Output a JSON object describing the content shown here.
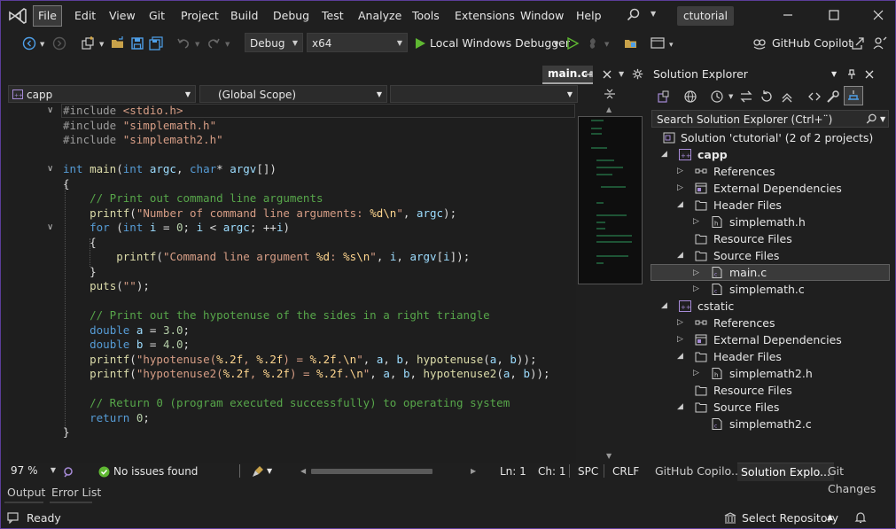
{
  "menu": [
    "File",
    "Edit",
    "View",
    "Git",
    "Project",
    "Build",
    "Debug",
    "Test",
    "Analyze",
    "Tools",
    "Extensions",
    "Window",
    "Help"
  ],
  "solution_name_badge": "ctutorial",
  "toolbar": {
    "config": "Debug",
    "platform": "x64",
    "debugger_label": "Local Windows Debugger",
    "copilot_label": "GitHub Copilot"
  },
  "editor": {
    "tab_label": "main.c",
    "project_combo": "capp",
    "scope_combo": "(Global Scope)",
    "zoom": "97 %",
    "issues": "No issues found",
    "ln": "Ln: 1",
    "ch": "Ch: 1",
    "indent": "SPC",
    "eol": "CRLF"
  },
  "code_lines": [
    "#include <stdio.h>",
    "#include \"simplemath.h\"",
    "#include \"simplemath2.h\"",
    "",
    "int main(int argc, char* argv[])",
    "{",
    "    // Print out command line arguments",
    "    printf(\"Number of command line arguments: %d\\n\", argc);",
    "    for (int i = 0; i < argc; ++i)",
    "    {",
    "        printf(\"Command line argument %d: %s\\n\", i, argv[i]);",
    "    }",
    "    puts(\"\");",
    "",
    "    // Print out the hypotenuse of the sides in a right triangle",
    "    double a = 3.0;",
    "    double b = 4.0;",
    "    printf(\"hypotenuse(%.2f, %.2f) = %.2f.\\n\", a, b, hypotenuse(a, b));",
    "    printf(\"hypotenuse2(%.2f, %.2f) = %.2f.\\n\", a, b, hypotenuse2(a, b));",
    "",
    "    // Return 0 (program executed successfully) to operating system",
    "    return 0;",
    "}"
  ],
  "solution_explorer": {
    "title": "Solution Explorer",
    "search_placeholder": "Search Solution Explorer (Ctrl+¨)",
    "nodes": [
      "Solution 'ctutorial' (2 of 2 projects)",
      "capp",
      "References",
      "External Dependencies",
      "Header Files",
      "simplemath.h",
      "Resource Files",
      "Source Files",
      "main.c",
      "simplemath.c",
      "cstatic",
      "References",
      "External Dependencies",
      "Header Files",
      "simplemath2.h",
      "Resource Files",
      "Source Files",
      "simplemath2.c"
    ],
    "bottom_tabs": [
      "GitHub Copilo...",
      "Solution Explo...",
      "Git Changes"
    ]
  },
  "output_tabs": [
    "Output",
    "Error List"
  ],
  "status": {
    "ready": "Ready",
    "repo": "Select Repository"
  },
  "colors": {
    "accent_purple": "#5b3d99",
    "keyword": "#569cd6",
    "string": "#d69d85",
    "comment": "#57a64a",
    "function": "#dcdcaa",
    "variable": "#9cdcfe",
    "number": "#b5cea8",
    "play_green": "#5fb832"
  }
}
